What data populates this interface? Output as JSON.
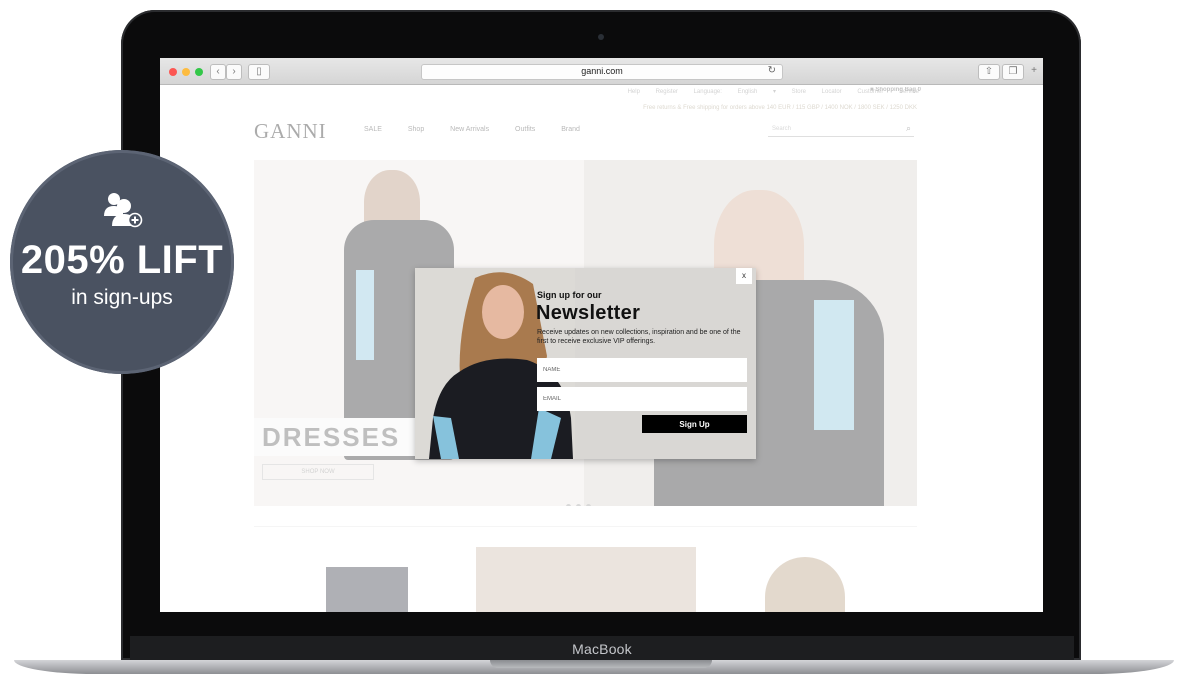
{
  "browser": {
    "url": "ganni.com"
  },
  "site": {
    "topbar_links": "Help   Register   Language: English ▾   Store Locator   Customer Service",
    "bag_label": "Shopping Bag  0",
    "shipping_note": "Free returns & Free shipping for orders above 140 EUR / 115 GBP / 1400 NOK / 1800 SEK / 1250 DKK",
    "logo": "GANNI",
    "nav": [
      "SALE",
      "Shop",
      "New Arrivals",
      "Outfits",
      "Brand"
    ],
    "search_placeholder": "Search",
    "hero": {
      "category": "DRESSES",
      "cta": "SHOP NOW"
    }
  },
  "modal": {
    "close_label": "x",
    "kicker": "Sign up for our",
    "title": "Newsletter",
    "description": "Receive updates on new collections, inspiration and be one of the first to receive exclusive VIP offerings.",
    "name_placeholder": "NAME",
    "email_placeholder": "EMAIL",
    "submit_label": "Sign Up"
  },
  "badge": {
    "value": "205% LIFT",
    "caption": "in sign-ups",
    "icon": "add-user-icon"
  },
  "device": {
    "label": "MacBook"
  },
  "colors": {
    "badge": "#4a5261",
    "modal_bg": "#d9d7d4",
    "button": "#000000",
    "traffic_red": "#fc5753",
    "traffic_yellow": "#fdbc40",
    "traffic_green": "#33c748"
  }
}
